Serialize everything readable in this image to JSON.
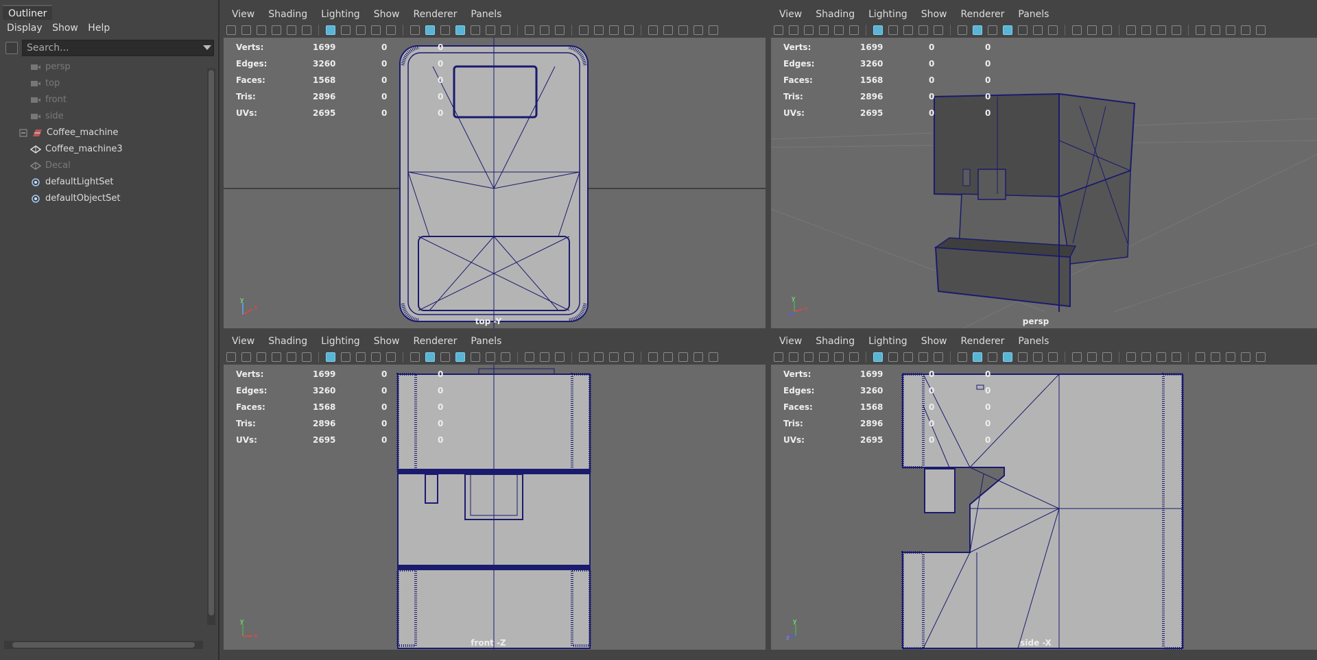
{
  "outliner": {
    "title": "Outliner",
    "menu": [
      "Display",
      "Show",
      "Help"
    ],
    "search_placeholder": "Search...",
    "items": [
      {
        "label": "persp",
        "type": "camera",
        "dim": true
      },
      {
        "label": "top",
        "type": "camera",
        "dim": true
      },
      {
        "label": "front",
        "type": "camera",
        "dim": true
      },
      {
        "label": "side",
        "type": "camera",
        "dim": true
      },
      {
        "label": "Coffee_machine",
        "type": "group",
        "dim": false
      },
      {
        "label": "Coffee_machine3",
        "type": "mesh",
        "dim": false
      },
      {
        "label": "Decal",
        "type": "mesh",
        "dim": true
      },
      {
        "label": "defaultLightSet",
        "type": "set",
        "dim": false
      },
      {
        "label": "defaultObjectSet",
        "type": "set",
        "dim": false
      }
    ]
  },
  "viewport_menu": [
    "View",
    "Shading",
    "Lighting",
    "Show",
    "Renderer",
    "Panels"
  ],
  "hud": {
    "rows": [
      {
        "key": "Verts:",
        "a": "1699",
        "b": "0",
        "c": "0"
      },
      {
        "key": "Edges:",
        "a": "3260",
        "b": "0",
        "c": "0"
      },
      {
        "key": "Faces:",
        "a": "1568",
        "b": "0",
        "c": "0"
      },
      {
        "key": "Tris:",
        "a": "2896",
        "b": "0",
        "c": "0"
      },
      {
        "key": "UVs:",
        "a": "2695",
        "b": "0",
        "c": "0"
      }
    ]
  },
  "viewports": {
    "top": {
      "camera": "top -Y",
      "axis1": "y",
      "axis2": "x"
    },
    "persp": {
      "camera": "persp",
      "axis1": "y",
      "axis2": "x"
    },
    "front": {
      "camera": "front -Z",
      "axis1": "y",
      "axis2": "x"
    },
    "side": {
      "camera": "side -X",
      "axis1": "y",
      "axis2": "z"
    }
  },
  "colors": {
    "wire": "#1a1a6e",
    "mesh": "#b4b4b4",
    "accent": "#5ab4d4"
  }
}
